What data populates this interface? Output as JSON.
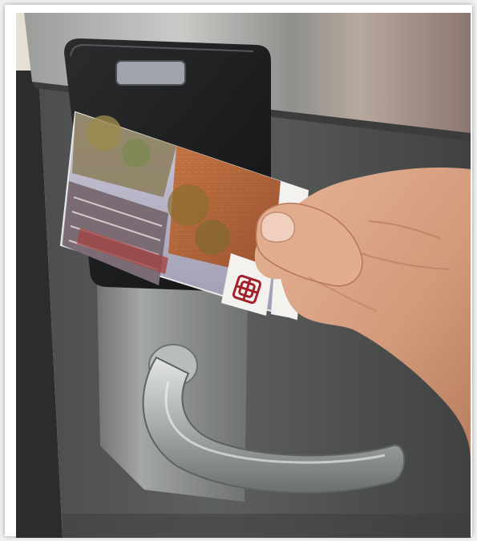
{
  "image": {
    "subject": "",
    "colors": {
      "frame": "#ffffff",
      "wall": "#d9d3c7",
      "door_steel": "#8c8f8e",
      "reader_body": "#1c1d1f",
      "card_white": "#f4f2ee",
      "card_brick": "#b5653a",
      "logo_red": "#a3202a",
      "skin": "#d9a283",
      "handle": "#bfc2c3"
    }
  }
}
